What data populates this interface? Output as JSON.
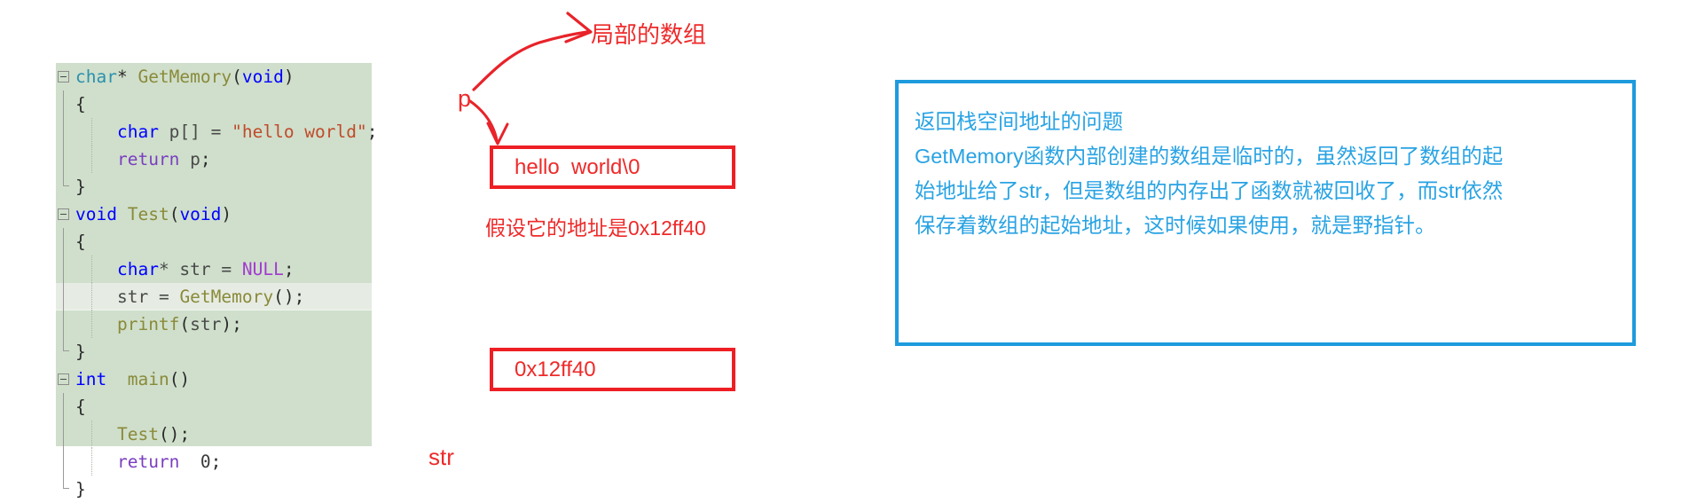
{
  "code_panel": {
    "language": "c",
    "background_color": "#cfdfcb",
    "lines": [
      {
        "id": "l1",
        "indent": 0,
        "collapse": "start",
        "highlight": false,
        "tokens": [
          {
            "t": "char",
            "c": "type"
          },
          {
            "t": "* ",
            "c": "plain"
          },
          {
            "t": "GetMemory",
            "c": "fn"
          },
          {
            "t": "(",
            "c": "plain"
          },
          {
            "t": "void",
            "c": "kw"
          },
          {
            "t": ")",
            "c": "plain"
          }
        ]
      },
      {
        "id": "l2",
        "indent": 0,
        "collapse": "bar",
        "highlight": false,
        "tokens": [
          {
            "t": "{",
            "c": "plain"
          }
        ]
      },
      {
        "id": "l3",
        "indent": 1,
        "collapse": "bar",
        "highlight": false,
        "tokens": [
          {
            "t": "    ",
            "c": "plain"
          },
          {
            "t": "char",
            "c": "kw"
          },
          {
            "t": " p[] = ",
            "c": "ident"
          },
          {
            "t": "\"hello world\"",
            "c": "str"
          },
          {
            "t": ";",
            "c": "plain"
          }
        ]
      },
      {
        "id": "l4",
        "indent": 1,
        "collapse": "bar",
        "highlight": false,
        "tokens": [
          {
            "t": "    ",
            "c": "plain"
          },
          {
            "t": "return",
            "c": "kw2"
          },
          {
            "t": " p",
            "c": "ident"
          },
          {
            "t": ";",
            "c": "plain"
          }
        ]
      },
      {
        "id": "l5",
        "indent": 0,
        "collapse": "end",
        "highlight": false,
        "tokens": [
          {
            "t": "}",
            "c": "plain"
          }
        ]
      },
      {
        "id": "l6",
        "indent": 0,
        "collapse": "start",
        "highlight": false,
        "tokens": [
          {
            "t": "void",
            "c": "kw"
          },
          {
            "t": " ",
            "c": "plain"
          },
          {
            "t": "Test",
            "c": "fn"
          },
          {
            "t": "(",
            "c": "plain"
          },
          {
            "t": "void",
            "c": "kw"
          },
          {
            "t": ")",
            "c": "plain"
          }
        ]
      },
      {
        "id": "l7",
        "indent": 0,
        "collapse": "bar",
        "highlight": false,
        "tokens": [
          {
            "t": "{",
            "c": "plain"
          }
        ]
      },
      {
        "id": "l8",
        "indent": 1,
        "collapse": "bar",
        "highlight": false,
        "tokens": [
          {
            "t": "    ",
            "c": "plain"
          },
          {
            "t": "char",
            "c": "kw"
          },
          {
            "t": "* ",
            "c": "ident"
          },
          {
            "t": "str",
            "c": "ident"
          },
          {
            "t": " = ",
            "c": "ident"
          },
          {
            "t": "NULL",
            "c": "macro"
          },
          {
            "t": ";",
            "c": "plain"
          }
        ]
      },
      {
        "id": "l9",
        "indent": 1,
        "collapse": "bar",
        "highlight": true,
        "tokens": [
          {
            "t": "    ",
            "c": "plain"
          },
          {
            "t": "str",
            "c": "ident"
          },
          {
            "t": " = ",
            "c": "ident"
          },
          {
            "t": "GetMemory",
            "c": "fn"
          },
          {
            "t": "();",
            "c": "plain"
          }
        ]
      },
      {
        "id": "l10",
        "indent": 1,
        "collapse": "bar",
        "highlight": false,
        "tokens": [
          {
            "t": "    ",
            "c": "plain"
          },
          {
            "t": "printf",
            "c": "fn"
          },
          {
            "t": "(",
            "c": "plain"
          },
          {
            "t": "str",
            "c": "ident"
          },
          {
            "t": ");",
            "c": "plain"
          }
        ]
      },
      {
        "id": "l11",
        "indent": 0,
        "collapse": "end",
        "highlight": false,
        "tokens": [
          {
            "t": "}",
            "c": "plain"
          }
        ]
      },
      {
        "id": "l12",
        "indent": 0,
        "collapse": "start",
        "highlight": false,
        "tokens": [
          {
            "t": "int",
            "c": "kw"
          },
          {
            "t": "  ",
            "c": "plain"
          },
          {
            "t": "main",
            "c": "fn"
          },
          {
            "t": "()",
            "c": "plain"
          }
        ]
      },
      {
        "id": "l13",
        "indent": 0,
        "collapse": "bar",
        "highlight": false,
        "tokens": [
          {
            "t": "{",
            "c": "plain"
          }
        ]
      },
      {
        "id": "l14",
        "indent": 1,
        "collapse": "bar",
        "highlight": false,
        "tokens": [
          {
            "t": "    ",
            "c": "plain"
          },
          {
            "t": "Test",
            "c": "fn"
          },
          {
            "t": "();",
            "c": "plain"
          }
        ]
      },
      {
        "id": "l15",
        "indent": 1,
        "collapse": "bar",
        "highlight": false,
        "tokens": [
          {
            "t": "    ",
            "c": "plain"
          },
          {
            "t": "return",
            "c": "kw2"
          },
          {
            "t": "  ",
            "c": "plain"
          },
          {
            "t": "0",
            "c": "num"
          },
          {
            "t": ";",
            "c": "plain"
          }
        ]
      },
      {
        "id": "l16",
        "indent": 0,
        "collapse": "end",
        "highlight": false,
        "tokens": [
          {
            "t": "}",
            "c": "plain"
          }
        ]
      }
    ]
  },
  "diagram": {
    "accent_color": "#ee2a2a",
    "local_array_label": "局部的数组",
    "pointer_p_label": "p",
    "array_box_text": "hello  world\\0",
    "address_note": "假设它的地址是0x12ff40",
    "str_box_value": "0x12ff40",
    "str_label": "str"
  },
  "blue_note": {
    "border_color": "#1e9bdd",
    "text_color": "#29a3e3",
    "title": "返回栈空间地址的问题",
    "line2": "GetMemory函数内部创建的数组是临时的，虽然返回了数组的起",
    "line3": "始地址给了str，但是数组的内存出了函数就被回收了，而str依然",
    "line4": "保存着数组的起始地址，这时候如果使用，就是野指针。"
  }
}
